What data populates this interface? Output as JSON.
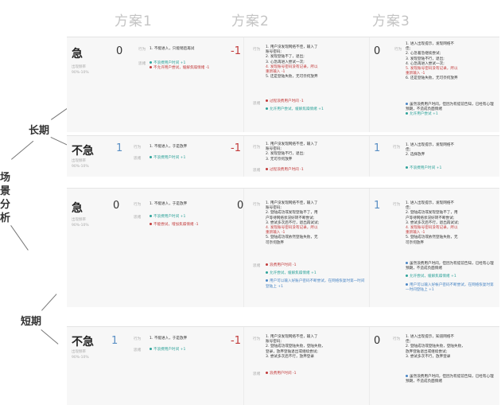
{
  "columns": [
    "方案1",
    "方案2",
    "方案3"
  ],
  "side": {
    "main": "场景分析",
    "long": "长期",
    "short": "短期"
  },
  "labels": {
    "action": "行为",
    "emotion": "思绪"
  },
  "meta": {
    "line1": "出现频率",
    "line2": "90%-10%",
    "line3": "90%-10%"
  },
  "rows": [
    {
      "urgency": "急",
      "scores": [
        "0",
        "-1",
        "0"
      ],
      "s1": {
        "action": "1. 不能进入，只能稍后再试",
        "e1": "不浪费用户时间 +1",
        "e2": "不允许用户尝试，缓解焦躁情绪 -1"
      },
      "s2": {
        "action": [
          "1. 用户没发现网络不佳，输入了",
          "账号密码;",
          "2. 发现登陆不了，退出;",
          "3. 心急再进入尝试一次;",
          "4. 发现账号密码没有记录，所以",
          "重新输入 -1",
          "5. 还是登陆失败，无可奈何放弃"
        ],
        "e1": "过程浪费用户时间 -1",
        "e2": "允许用户尝试，缓解焦躁情绪 +1"
      },
      "s3": {
        "action": [
          "1. 进入出现提示，发现网络不",
          "佳;",
          "2. 心急着急继续尝试;",
          "3. 发现登陆不行，退出;",
          "4. 心急再进入尝试一次;",
          "5. 发现账号密码没有记录，所以",
          "重新输入 -1",
          "6. 还是登陆失败，无可奈何放弃"
        ],
        "e1": "虽然浪费用户时间，但因为有提前告知，已经有心理预期，不造成负面情绪",
        "e2": "允许用户尝试 +1"
      }
    },
    {
      "urgency": "不急",
      "scores": [
        "1",
        "-1",
        "1"
      ],
      "s1": {
        "action": "1. 不能进入，于是放弃",
        "e1": "不浪费用户时间 +1"
      },
      "s2": {
        "action": [
          "1. 用户没发现网络不佳，输入了",
          "账号密码;",
          "2. 发现登陆不行，退出;",
          "3. 无可奈何放弃"
        ],
        "e1": "过程浪费用户时间 -1"
      },
      "s3": {
        "action": [
          "1. 进入出现提示，发现网络不",
          "佳;",
          "2. 选择放弃"
        ],
        "e1": "不浪费用户时间 +1"
      }
    },
    {
      "urgency": "急",
      "scores": [
        "0",
        "0",
        "1"
      ],
      "s1": {
        "action": "1. 不能进入，于是放弃",
        "e1": "不浪费用户时间 +1",
        "e2": "不能尝试，增加焦躁情绪 -1"
      },
      "s2": {
        "action": [
          "1. 用户没发现网络不佳，输入了",
          "账号密码;",
          "2. 登陆成功或发现登陆不了，用",
          "户等待网络状况好转不断尝试;",
          "3. 尝试多次后不行，退出再试试;",
          "4. 发现账号密码没有记录，所以",
          "重新输入 -1",
          "5. 登陆成功或依然登陆失败，无",
          "可奈何放弃"
        ],
        "e1": "浪费用户时间 -1",
        "e2": "允许尝试，缓解焦躁情绪 +1",
        "e3": "用户可以输入好账户密码不断尝试，在网络恢复时第一时间登陆上 +1"
      },
      "s3": {
        "action": [
          "1. 进入出现提示，发现网络不",
          "佳;",
          "2. 登陆成功或发现登陆不了，用",
          "户等待网络状况好转不断尝试;",
          "3. 尝试多次后不行，退出再试试;",
          "4. 发现账号密码没有记录，所以",
          "重新输入 -1",
          "5. 登陆成功或依然登陆失败，无",
          "可奈何放弃"
        ],
        "e1": "虽然浪费用户时间，但因为有提前告知，已经有心理预期，不造成负面情绪",
        "e2": "允许尝试，缓解焦躁情绪 +1",
        "e3": "用户可以输入好帐户密码不断尝试，在网络恢复时第一时间登陆上 +1"
      }
    },
    {
      "urgency": "不急",
      "scores": [
        "1",
        "-1",
        "0"
      ],
      "s1": {
        "action": "1. 不能进入，于是放弃",
        "e1": "不浪费用户时间 +1"
      },
      "s2": {
        "action": [
          "1. 用户没发现网络不佳，输入了",
          "账号密码;",
          "2. 登陆成功或登陆失败，登陆失败，",
          "登录，放弃登陆退出或继续尝试;",
          "3. 尝试多次后不行，放弃登录"
        ],
        "e1": "浪费用户时间 -1"
      },
      "s3": {
        "action": [
          "1. 进入出现提示，知道网络不",
          "佳;",
          "2. 登陆成功或登陆失败，登陆失败，",
          "放弃登陆退出或继续尝试;",
          "3. 尝试多次不行，放弃登录"
        ],
        "e1": "虽然浪费用户时间，但因为有提前告知，已经有心理预期，不造成负面情绪"
      }
    }
  ]
}
